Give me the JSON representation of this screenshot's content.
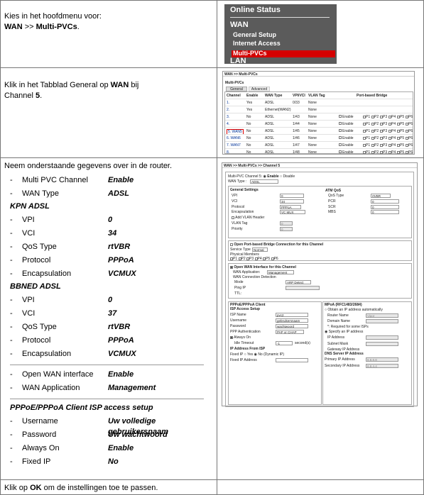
{
  "row1": {
    "instruction_line1": "Kies in het hoofdmenu voor:",
    "path_wan": "WAN",
    "path_sep": " >> ",
    "path_mpvc": "Multi-PVCs",
    "path_dot": ".",
    "screen": {
      "online_status": "Online Status",
      "wan": "WAN",
      "menu": [
        "General Setup",
        "Internet Access",
        "Multi-PVCs"
      ],
      "lan": "LAN"
    }
  },
  "row2": {
    "text_a": "Klik in het Tabblad General op ",
    "text_wan": "WAN",
    "text_b": " bij",
    "text_c": "Channel ",
    "text_5": "5",
    "text_d": ".",
    "screen": {
      "breadcrumb": "WAN >> Multi-PVCs",
      "section": "Multi-PVCs",
      "tabs": [
        "General",
        "Advanced"
      ],
      "headers": [
        "Channel",
        "Enable",
        "WAN Type",
        "VPI/VCI",
        "VLAN Tag",
        "Port-based Bridge"
      ],
      "rows": [
        [
          "1.",
          "Yes",
          "ADSL",
          "0/33",
          "None",
          ""
        ],
        [
          "2.",
          "Yes",
          "Ethernet(WAN2)",
          "",
          "None",
          ""
        ],
        [
          "3.",
          "No",
          "ADSL",
          "1/43",
          "None",
          "Enable"
        ],
        [
          "4.",
          "No",
          "ADSL",
          "1/44",
          "None",
          "Enable"
        ],
        [
          "5. WAN5",
          "No",
          "ADSL",
          "1/45",
          "None",
          "Enable"
        ],
        [
          "6. WAN6",
          "No",
          "ADSL",
          "1/46",
          "None",
          "Enable"
        ],
        [
          "7. WAN7",
          "No",
          "ADSL",
          "1/47",
          "None",
          "Enable"
        ],
        [
          "8.",
          "No",
          "ADSL",
          "1/48",
          "None",
          "Enable"
        ]
      ],
      "ports": [
        "P1",
        "P2",
        "P3",
        "P4",
        "P5",
        "P6"
      ]
    }
  },
  "row3": {
    "intro": "Neem onderstaande gegevens over in de router.",
    "items_top": [
      {
        "label": "Multi PVC Channel",
        "value": "Enable"
      },
      {
        "label": "WAN Type",
        "value": "ADSL"
      }
    ],
    "kpn_head": "KPN ADSL",
    "kpn_items": [
      {
        "label": "VPI",
        "value": "0"
      },
      {
        "label": "VCI",
        "value": "34"
      },
      {
        "label": "QoS Type",
        "value": "rtVBR"
      },
      {
        "label": "Protocol",
        "value": "PPPoA"
      },
      {
        "label": "Encapsulation",
        "value": "VCMUX"
      }
    ],
    "bbned_head": "BBNED ADSL",
    "bbned_items": [
      {
        "label": "VPI",
        "value": "0"
      },
      {
        "label": "VCI",
        "value": "37"
      },
      {
        "label": "QoS Type",
        "value": "rtVBR"
      },
      {
        "label": "Protocol",
        "value": "PPPoA"
      },
      {
        "label": "Encapsulation",
        "value": "VCMUX"
      }
    ],
    "wan_items": [
      {
        "label": "Open WAN interface",
        "value": "Enable"
      },
      {
        "label": "WAN Application",
        "value": "Management"
      }
    ],
    "isp_head": "PPPoE/PPPoA Client ISP access setup",
    "isp_items": [
      {
        "label": "Username",
        "value": "Uw volledige gebruikersnaam"
      },
      {
        "label": "Password",
        "value": "Uw wachtwoord"
      },
      {
        "label": "Always On",
        "value": "Enable"
      },
      {
        "label": "Fixed IP",
        "value": "No"
      }
    ],
    "screen": {
      "breadcrumb": "WAN >> Multi-PVCs >> Channel 5",
      "channel_label": "Multi-PVC Channel 5:",
      "enable": "Enable",
      "disable": "Disable",
      "wan_type_label": "WAN Type :",
      "wan_type_value": "ADSL",
      "general": "General Settings",
      "vpi": "VPI",
      "vpi_v": "0",
      "vci": "VCI",
      "vci_v": "34",
      "protocol": "Protocol",
      "protocol_v": "PPPoA",
      "encap": "Encapsulation",
      "encap_v": "VC MUX",
      "add_vlan": "Add VLAN Header",
      "vlan_tag": "VLAN Tag",
      "vlan_tag_v": "0",
      "priority": "Priority",
      "priority_v": "0",
      "atm": "ATM QoS",
      "qos": "QoS Type",
      "qos_v": "rtVBR",
      "pcr": "PCR",
      "pcr_v": "0",
      "scr": "SCR",
      "scr_v": "0",
      "mbs": "MBS",
      "mbs_v": "0",
      "bridge": "Open Port-based Bridge Connection for this Channel",
      "service_type": "Service Type",
      "service_type_v": "Normal",
      "phys": "Physical Members",
      "open_wan": "Open WAN Interface for this Channel",
      "wan_app": "WAN Application:",
      "wan_app_v": "Management",
      "wan_detect": "WAN Connection Detection",
      "mode": "Mode",
      "mode_v": "ARP Detect",
      "ping": "Ping IP",
      "ttl": "TTL:",
      "pppoa_head": "PPPoE/PPPoA Client",
      "isp_setup": "ISP Access Setup",
      "isp_name": "ISP Name",
      "isp_name_v": "pvc2",
      "username": "Username",
      "username_v": "gebruikersnaam",
      "password": "Password",
      "password_v": "wachtwoord",
      "ppp_auth": "PPP Authentication",
      "ppp_auth_v": "PAP or CHAP",
      "always_on": "Always On",
      "idle": "Idle Timeout",
      "idle_v": "-1",
      "idle_unit": "second(s)",
      "ip_from_isp": "IP Address From ISP",
      "fixed_ip": "Fixed IP",
      "yes": "Yes",
      "no": "No (Dynamic IP)",
      "fixed_ip_addr": "Fixed IP Address",
      "mpoa_head": "MPoA (RFC1483/2684)",
      "obtain": "Obtain an IP address automatically",
      "router_name": "Router Name",
      "router_name_v": "Vigor",
      "domain_name": "Domain Name",
      "required": "*: Required for some ISPs",
      "specify": "Specify an IP address",
      "ip_address": "IP Address",
      "subnet": "Subnet Mask",
      "gateway": "Gateway IP Address",
      "dns_head": "DNS Server IP Address",
      "primary": "Primary IP Address",
      "primary_v": "8.8.8.8",
      "secondary": "Secondary IP Address",
      "secondary_v": "8.8.4.4"
    }
  },
  "row4": {
    "text_a": "Klik op ",
    "text_ok": "OK",
    "text_b": " om de instellingen toe te passen."
  }
}
